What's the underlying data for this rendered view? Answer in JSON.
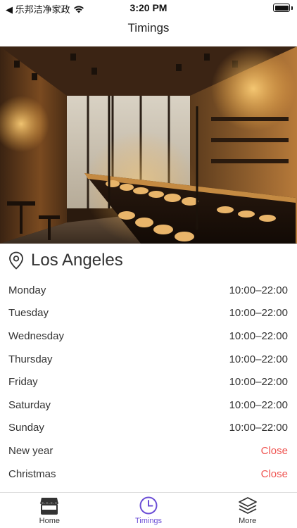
{
  "status_bar": {
    "carrier": "◀ 乐邦洁净家政",
    "time": "3:20 PM"
  },
  "nav": {
    "title": "Timings"
  },
  "location": {
    "name": "Los Angeles",
    "icon": "map-pin-icon"
  },
  "hours": [
    {
      "day": "Monday",
      "time": "10:00–22:00",
      "closed": false
    },
    {
      "day": "Tuesday",
      "time": "10:00–22:00",
      "closed": false
    },
    {
      "day": "Wednesday",
      "time": "10:00–22:00",
      "closed": false
    },
    {
      "day": "Thursday",
      "time": "10:00–22:00",
      "closed": false
    },
    {
      "day": "Friday",
      "time": "10:00–22:00",
      "closed": false
    },
    {
      "day": "Saturday",
      "time": "10:00–22:00",
      "closed": false
    },
    {
      "day": "Sunday",
      "time": "10:00–22:00",
      "closed": false
    },
    {
      "day": "New year",
      "time": "Close",
      "closed": true
    },
    {
      "day": "Christmas",
      "time": "Close",
      "closed": true
    }
  ],
  "tabs": [
    {
      "label": "Home",
      "icon": "store-icon",
      "active": false
    },
    {
      "label": "Timings",
      "icon": "clock-icon",
      "active": true
    },
    {
      "label": "More",
      "icon": "layers-icon",
      "active": false
    }
  ],
  "colors": {
    "accent": "#6c4fd6",
    "closed": "#ef5350"
  }
}
